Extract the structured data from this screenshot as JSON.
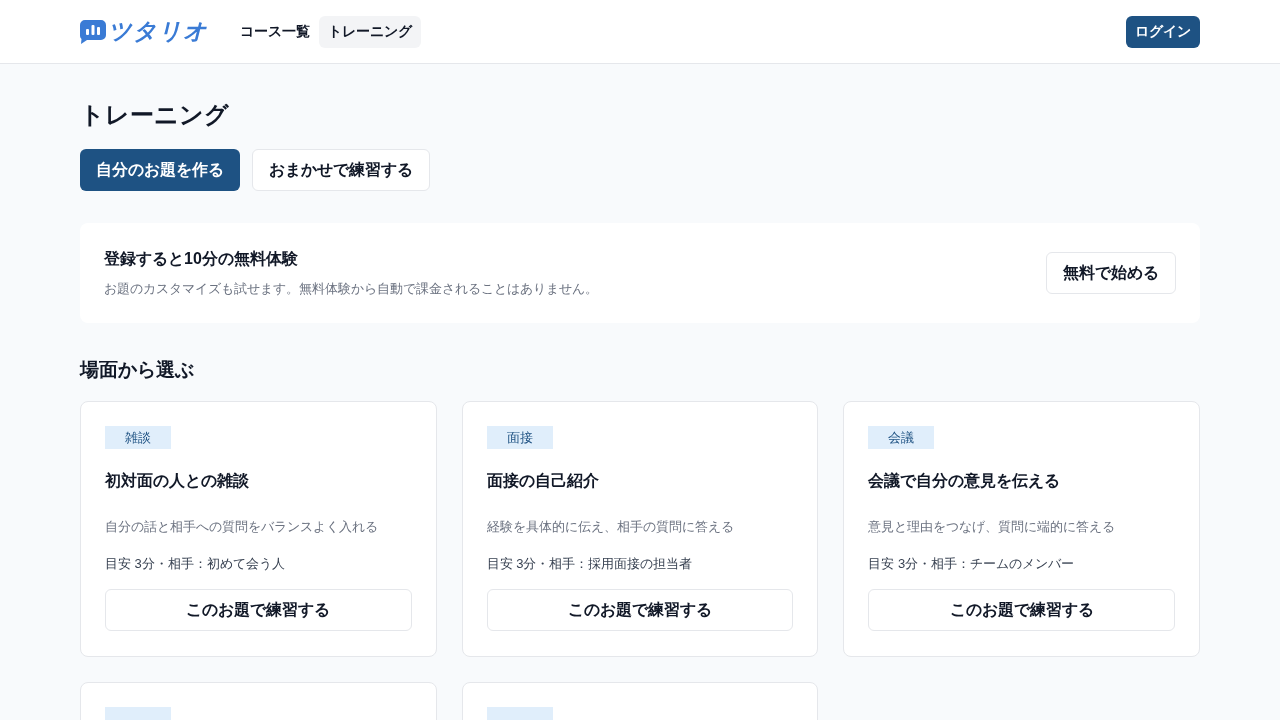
{
  "header": {
    "logo": {
      "text": "ツタリオ"
    },
    "nav": [
      {
        "label": "コース一覧",
        "selected": false
      },
      {
        "label": "トレーニング",
        "selected": true
      }
    ],
    "login_button": "ログイン"
  },
  "page": {
    "title": "トレーニング",
    "actions": [
      {
        "label": "自分のお題を作る",
        "kind": "primary"
      },
      {
        "label": "おまかせで練習する",
        "kind": "secondary"
      }
    ]
  },
  "trial_banner": {
    "title": "登録すると10分の無料体験",
    "description": "お題のカスタマイズも試せます。無料体験から自動で課金されることはありません。",
    "button": "無料で始める"
  },
  "scenes": {
    "heading": "場面から選ぶ",
    "cards": [
      {
        "kind": "topic",
        "tag": "雑談",
        "title": "初対面の人との雑談",
        "description": "自分の話と相手への質問をバランスよく入れる",
        "meta": "目安 3分・相手：初めて会う人",
        "button": "このお題で練習する"
      },
      {
        "kind": "topic",
        "tag": "面接",
        "title": "面接の自己紹介",
        "description": "経験を具体的に伝え、相手の質問に答える",
        "meta": "目安 3分・相手：採用面接の担当者",
        "button": "このお題で練習する"
      },
      {
        "kind": "topic",
        "tag": "会議",
        "title": "会議で自分の意見を伝える",
        "description": "意見と理由をつなげ、質問に端的に答える",
        "meta": "目安 3分・相手：チームのメンバー",
        "button": "このお題で練習する"
      },
      {
        "kind": "cut_off"
      },
      {
        "kind": "cut_off"
      }
    ]
  }
}
